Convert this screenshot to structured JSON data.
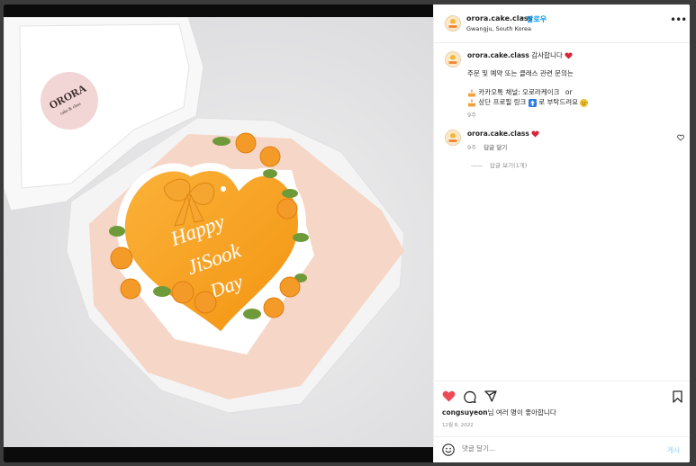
{
  "post": {
    "username": "orora.cake.class",
    "follow_label": "팔로우",
    "separator": "•",
    "location": "Gwangju, South Korea",
    "more_label": "•••"
  },
  "photo": {
    "box_brand": "ORORA",
    "box_sub": "cake & class",
    "cake_text": [
      "Happy",
      "JiSook",
      "Day"
    ],
    "colors": {
      "frosting": "#f7a21c",
      "rosette": "#f39a28",
      "leaf": "#6f9a3a",
      "background": "#e9e9ea"
    }
  },
  "caption": {
    "username": "orora.cake.class",
    "text": "감사합니다",
    "emoji_icon": "heart-icon",
    "line2": "주문 및 예약 또는 클래스 관련 문의는",
    "line3_text": "카카오톡 채널: 오로라케이크",
    "line3_suffix": "or",
    "line4_text": "상단 프로필 링크",
    "line4_suffix": "로 부탁드려요",
    "time": "9주"
  },
  "comment": {
    "username": "orora.cake.class",
    "time": "9주",
    "reply_label": "답글 달기",
    "view_replies": "답글 보기(1개)",
    "replies_dash": "——"
  },
  "footer": {
    "liker": "congsuyeon",
    "likes_suffix": "님 여러 명이 좋아합니다",
    "date": "12월 8, 2022",
    "comment_placeholder": "댓글 달기...",
    "post_label": "게시",
    "accent": "#0095f6",
    "like_color": "#ed4956"
  }
}
